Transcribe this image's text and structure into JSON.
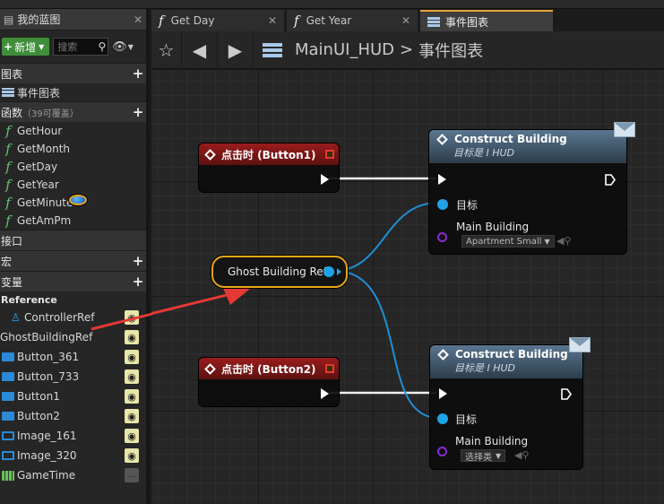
{
  "left_panel": {
    "tab_title": "我的蓝图",
    "new_button": "新增",
    "search_placeholder": "搜索",
    "sections": {
      "graphs": "图表",
      "graph_item": "事件图表",
      "functions": "函数",
      "functions_sub": "（39可覆盖）",
      "interfaces": "接口",
      "macros": "宏",
      "variables": "变量"
    },
    "functions": [
      "GetHour",
      "GetMonth",
      "GetDay",
      "GetYear",
      "GetMinute",
      "GetAmPm"
    ],
    "reference_header": "Reference",
    "variables": [
      {
        "name": "ControllerRef",
        "icon": "controller-ref-icon"
      },
      {
        "name": "GhostBuildingRef",
        "icon": "object-ref-icon"
      },
      {
        "name": "Button_361",
        "icon": "widget-icon"
      },
      {
        "name": "Button_733",
        "icon": "widget-icon"
      },
      {
        "name": "Button1",
        "icon": "widget-icon"
      },
      {
        "name": "Button2",
        "icon": "widget-icon"
      },
      {
        "name": "Image_161",
        "icon": "image-icon"
      },
      {
        "name": "Image_320",
        "icon": "image-icon"
      },
      {
        "name": "GameTime",
        "icon": "grid-icon"
      }
    ]
  },
  "tabs": [
    {
      "label": "Get Day"
    },
    {
      "label": "Get Year"
    },
    {
      "label": "事件图表"
    }
  ],
  "breadcrumb": {
    "root": "MainUI_HUD",
    "current": "事件图表"
  },
  "nodes": {
    "event1_title": "点击时 (Button1)",
    "event2_title": "点击时 (Button2)",
    "construct1_title": "Construct Building",
    "construct1_sub": "目标是 I HUD",
    "construct2_title": "Construct Building",
    "construct2_sub": "目标是 I HUD",
    "target_label": "目标",
    "main_building_label": "Main Building",
    "combo1_value": "Apartment Small",
    "combo2_value": "选择类",
    "ghost_ref": "Ghost Building Ref"
  },
  "colors": {
    "accent_tab": "#e8a33a",
    "event_header": "#9a1c1c",
    "object_pin": "#1fa1e8",
    "class_pin": "#8a2ad0",
    "annotation_arrow": "#e53935"
  }
}
